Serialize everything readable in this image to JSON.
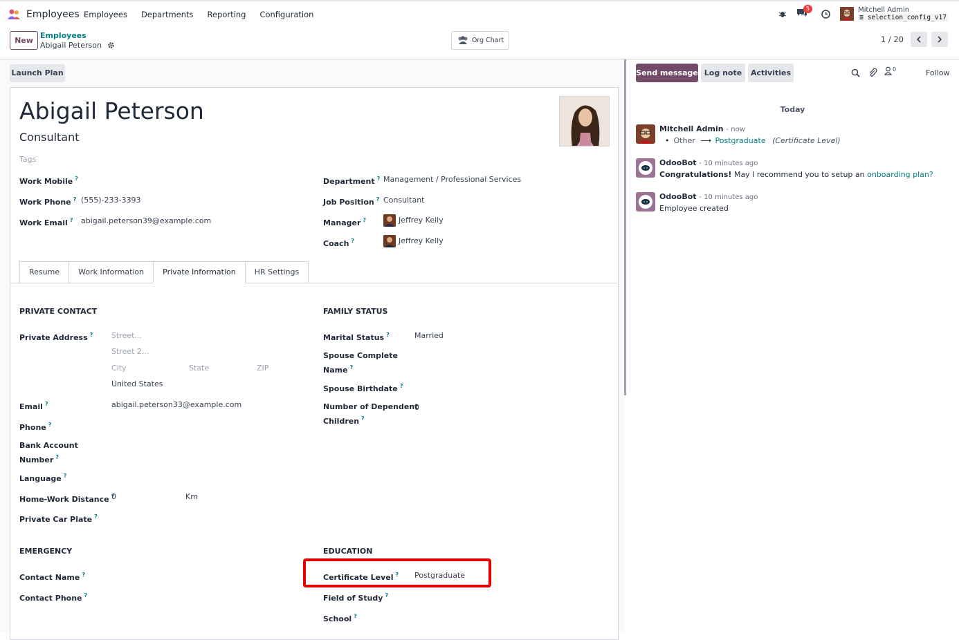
{
  "navbar": {
    "app_name": "Employees",
    "menu": [
      "Employees",
      "Departments",
      "Reporting",
      "Configuration"
    ],
    "messages_count": "5",
    "user_name": "Mitchell Admin",
    "db_name": "selection_config_v17"
  },
  "control_panel": {
    "new_label": "New",
    "breadcrumb_parent": "Employees",
    "breadcrumb_current": "Abigail Peterson",
    "org_chart_label": "Org Chart",
    "pager": "1 / 20"
  },
  "form": {
    "launch_plan_label": "Launch Plan",
    "name": "Abigail Peterson",
    "job_title": "Consultant",
    "tags_placeholder": "Tags",
    "left_fields": [
      {
        "label": "Work Mobile",
        "value": ""
      },
      {
        "label": "Work Phone",
        "value": "(555)-233-3393"
      },
      {
        "label": "Work Email",
        "value": "abigail.peterson39@example.com"
      }
    ],
    "right_fields": [
      {
        "label": "Department",
        "value": "Management / Professional Services"
      },
      {
        "label": "Job Position",
        "value": "Consultant"
      },
      {
        "label": "Manager",
        "value": "Jeffrey Kelly"
      },
      {
        "label": "Coach",
        "value": "Jeffrey Kelly"
      }
    ],
    "tabs": [
      "Resume",
      "Work Information",
      "Private Information",
      "HR Settings"
    ],
    "active_tab": "Private Information",
    "private_contact": {
      "title": "PRIVATE CONTACT",
      "address_label": "Private Address",
      "street_ph": "Street...",
      "street2_ph": "Street 2...",
      "city_ph": "City",
      "state_ph": "State",
      "zip_ph": "ZIP",
      "country": "United States",
      "email_label": "Email",
      "email": "abigail.peterson33@example.com",
      "phone_label": "Phone",
      "bank_label_1": "Bank Account",
      "bank_label_2": "Number",
      "language_label": "Language",
      "distance_label": "Home-Work Distance",
      "distance_value": "0",
      "distance_unit": "Km",
      "car_label": "Private Car Plate"
    },
    "family_status": {
      "title": "FAMILY STATUS",
      "marital_label": "Marital Status",
      "marital_value": "Married",
      "spouse_name_label_1": "Spouse Complete",
      "spouse_name_label_2": "Name",
      "spouse_birth_label": "Spouse Birthdate",
      "children_label_1": "Number of Dependent",
      "children_label_2": "Children",
      "children_value": "0"
    },
    "emergency": {
      "title": "EMERGENCY",
      "contact_name_label": "Contact Name",
      "contact_phone_label": "Contact Phone"
    },
    "education": {
      "title": "EDUCATION",
      "certificate_label": "Certificate Level",
      "certificate_value": "Postgraduate",
      "field_label": "Field of Study",
      "school_label": "School"
    },
    "help_mark": "?"
  },
  "chatter": {
    "send_message": "Send message",
    "log_note": "Log note",
    "activities": "Activities",
    "followers_count": "0",
    "follow": "Follow",
    "today": "Today",
    "messages": [
      {
        "author": "Mitchell Admin",
        "time": "- now",
        "old": "Other",
        "arrow": "⟶",
        "new": "Postgraduate",
        "field": "(Certificate Level)"
      },
      {
        "author": "OdooBot",
        "time": "- 10 minutes ago",
        "bold": "Congratulations!",
        "text": " May I recommend you to setup an ",
        "link": "onboarding plan?"
      },
      {
        "author": "OdooBot",
        "time": "- 10 minutes ago",
        "text": "Employee created"
      }
    ]
  },
  "colors": {
    "brand": "#714b67",
    "link": "#017e84",
    "highlight": "#e00000"
  }
}
